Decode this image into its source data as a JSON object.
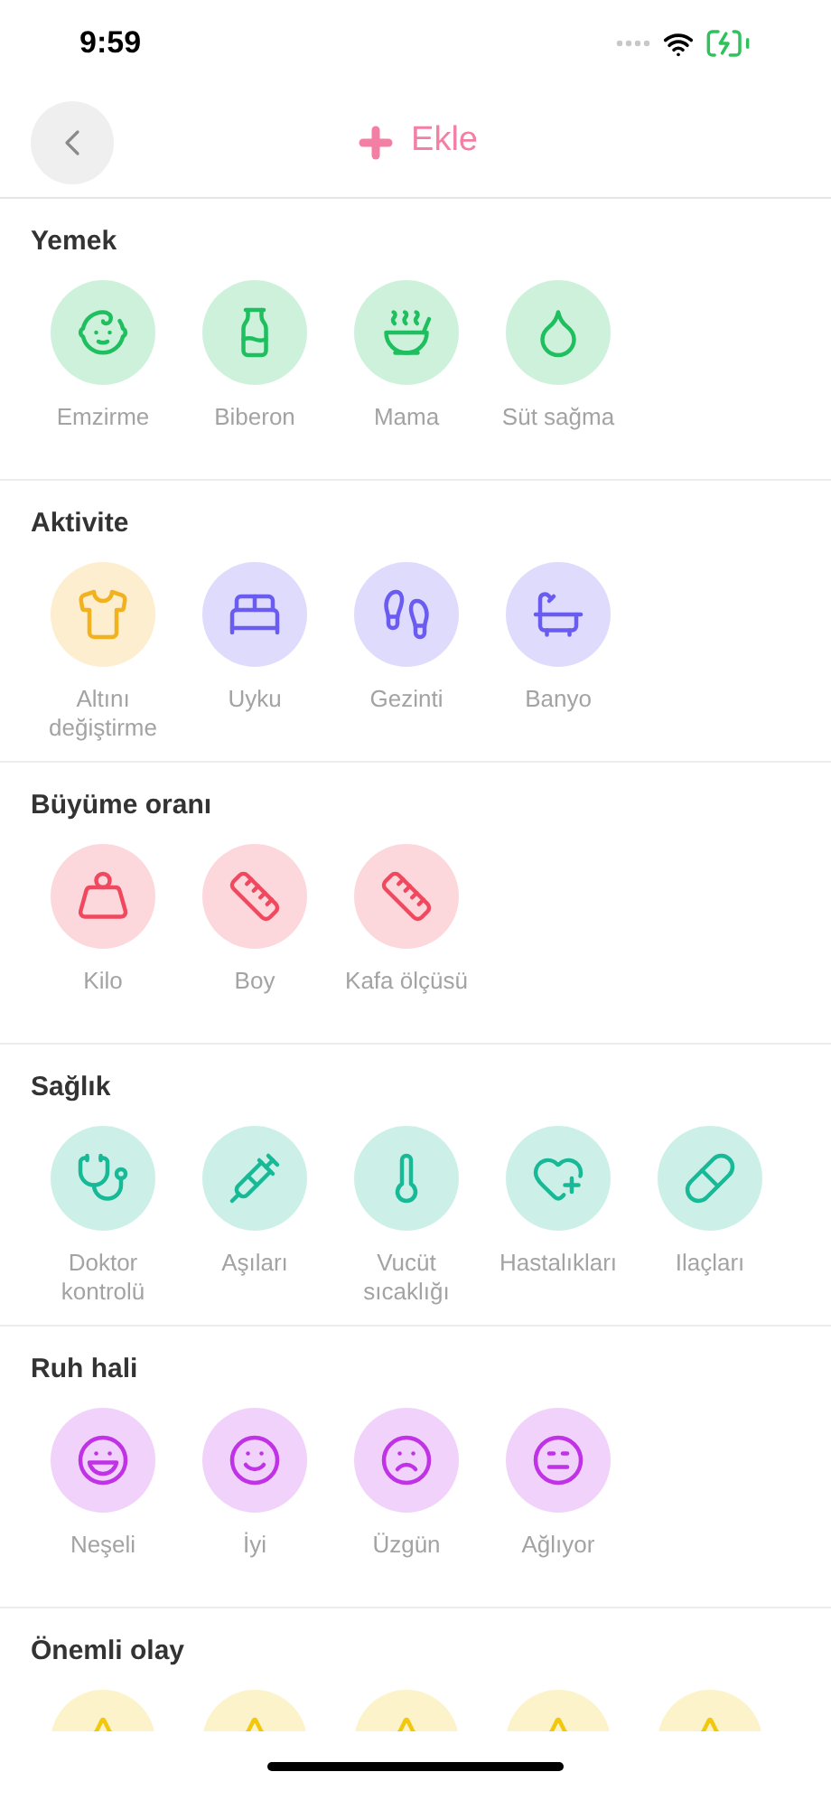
{
  "status_bar": {
    "time": "9:59"
  },
  "header": {
    "title": "Ekle"
  },
  "sections": [
    {
      "title": "Yemek",
      "items": [
        {
          "label": "Emzirme",
          "color": "#1fbf5f"
        },
        {
          "label": "Biberon",
          "color": "#1fbf5f"
        },
        {
          "label": "Mama",
          "color": "#1fbf5f"
        },
        {
          "label": "Süt sağma",
          "color": "#1fbf5f"
        }
      ]
    },
    {
      "title": "Aktivite",
      "items": [
        {
          "label": "Altını değiştirme",
          "color": "#f2b11e"
        },
        {
          "label": "Uyku",
          "color": "#6a5cf0"
        },
        {
          "label": "Gezinti",
          "color": "#6a5cf0"
        },
        {
          "label": "Banyo",
          "color": "#6a5cf0"
        }
      ]
    },
    {
      "title": "Büyüme oranı",
      "items": [
        {
          "label": "Kilo",
          "color": "#f0485e"
        },
        {
          "label": "Boy",
          "color": "#f0485e"
        },
        {
          "label": "Kafa ölçüsü",
          "color": "#f0485e"
        }
      ]
    },
    {
      "title": "Sağlık",
      "items": [
        {
          "label": "Doktor kontrolü",
          "color": "#17b996"
        },
        {
          "label": "Aşıları",
          "color": "#17b996"
        },
        {
          "label": "Vucüt sıcaklığı",
          "color": "#17b996"
        },
        {
          "label": "Hastalıkları",
          "color": "#17b996"
        },
        {
          "label": "Ilaçları",
          "color": "#17b996"
        }
      ]
    },
    {
      "title": "Ruh hali",
      "items": [
        {
          "label": "Neşeli",
          "color": "#c032e6"
        },
        {
          "label": "İyi",
          "color": "#c032e6"
        },
        {
          "label": "Üzgün",
          "color": "#c032e6"
        },
        {
          "label": "Ağlıyor",
          "color": "#c032e6"
        }
      ]
    },
    {
      "title": "Önemli olay",
      "items": [
        {
          "color": "#f2c80f"
        },
        {
          "color": "#f2c80f"
        },
        {
          "color": "#f2c80f"
        },
        {
          "color": "#f2c80f"
        },
        {
          "color": "#f2c80f"
        }
      ]
    }
  ]
}
